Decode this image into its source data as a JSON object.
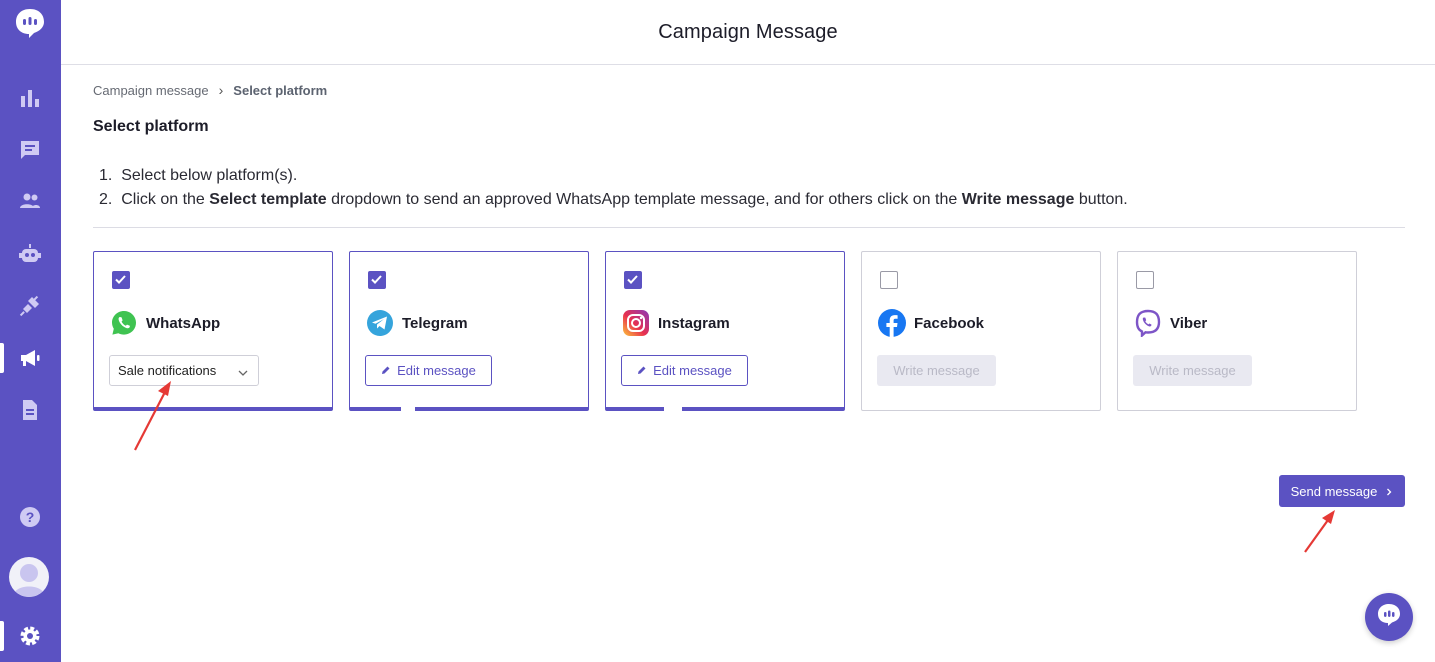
{
  "sidebar": {
    "logo": "chat-logo-icon",
    "items": [
      {
        "icon": "analytics-icon",
        "active": false
      },
      {
        "icon": "messages-icon",
        "active": false
      },
      {
        "icon": "contacts-icon",
        "active": false
      },
      {
        "icon": "bot-icon",
        "active": false
      },
      {
        "icon": "integrations-icon",
        "active": false
      },
      {
        "icon": "campaign-icon",
        "active": true
      },
      {
        "icon": "templates-icon",
        "active": false
      }
    ],
    "bottom": [
      {
        "icon": "help-icon"
      },
      {
        "icon": "avatar"
      },
      {
        "icon": "settings-icon",
        "active": true
      }
    ]
  },
  "header": {
    "title": "Campaign Message"
  },
  "breadcrumb": {
    "parent": "Campaign message",
    "separator": "›",
    "current": "Select platform"
  },
  "section": {
    "title": "Select platform"
  },
  "instructions": {
    "line1": "Select below platform(s).",
    "line2_a": "Click on the ",
    "line2_b": "Select template",
    "line2_c": " dropdown to send an approved WhatsApp template message, and for others click on the ",
    "line2_d": "Write message",
    "line2_e": " button."
  },
  "platforms": [
    {
      "name": "WhatsApp",
      "checked": true,
      "control": "select",
      "value": "Sale notifications"
    },
    {
      "name": "Telegram",
      "checked": true,
      "control": "edit",
      "label": "Edit message"
    },
    {
      "name": "Instagram",
      "checked": true,
      "control": "edit",
      "label": "Edit message"
    },
    {
      "name": "Facebook",
      "checked": false,
      "control": "write",
      "label": "Write message"
    },
    {
      "name": "Viber",
      "checked": false,
      "control": "write",
      "label": "Write message"
    }
  ],
  "actions": {
    "send_label": "Send message"
  },
  "colors": {
    "accent": "#5b52c2",
    "annotation": "#e53935"
  }
}
